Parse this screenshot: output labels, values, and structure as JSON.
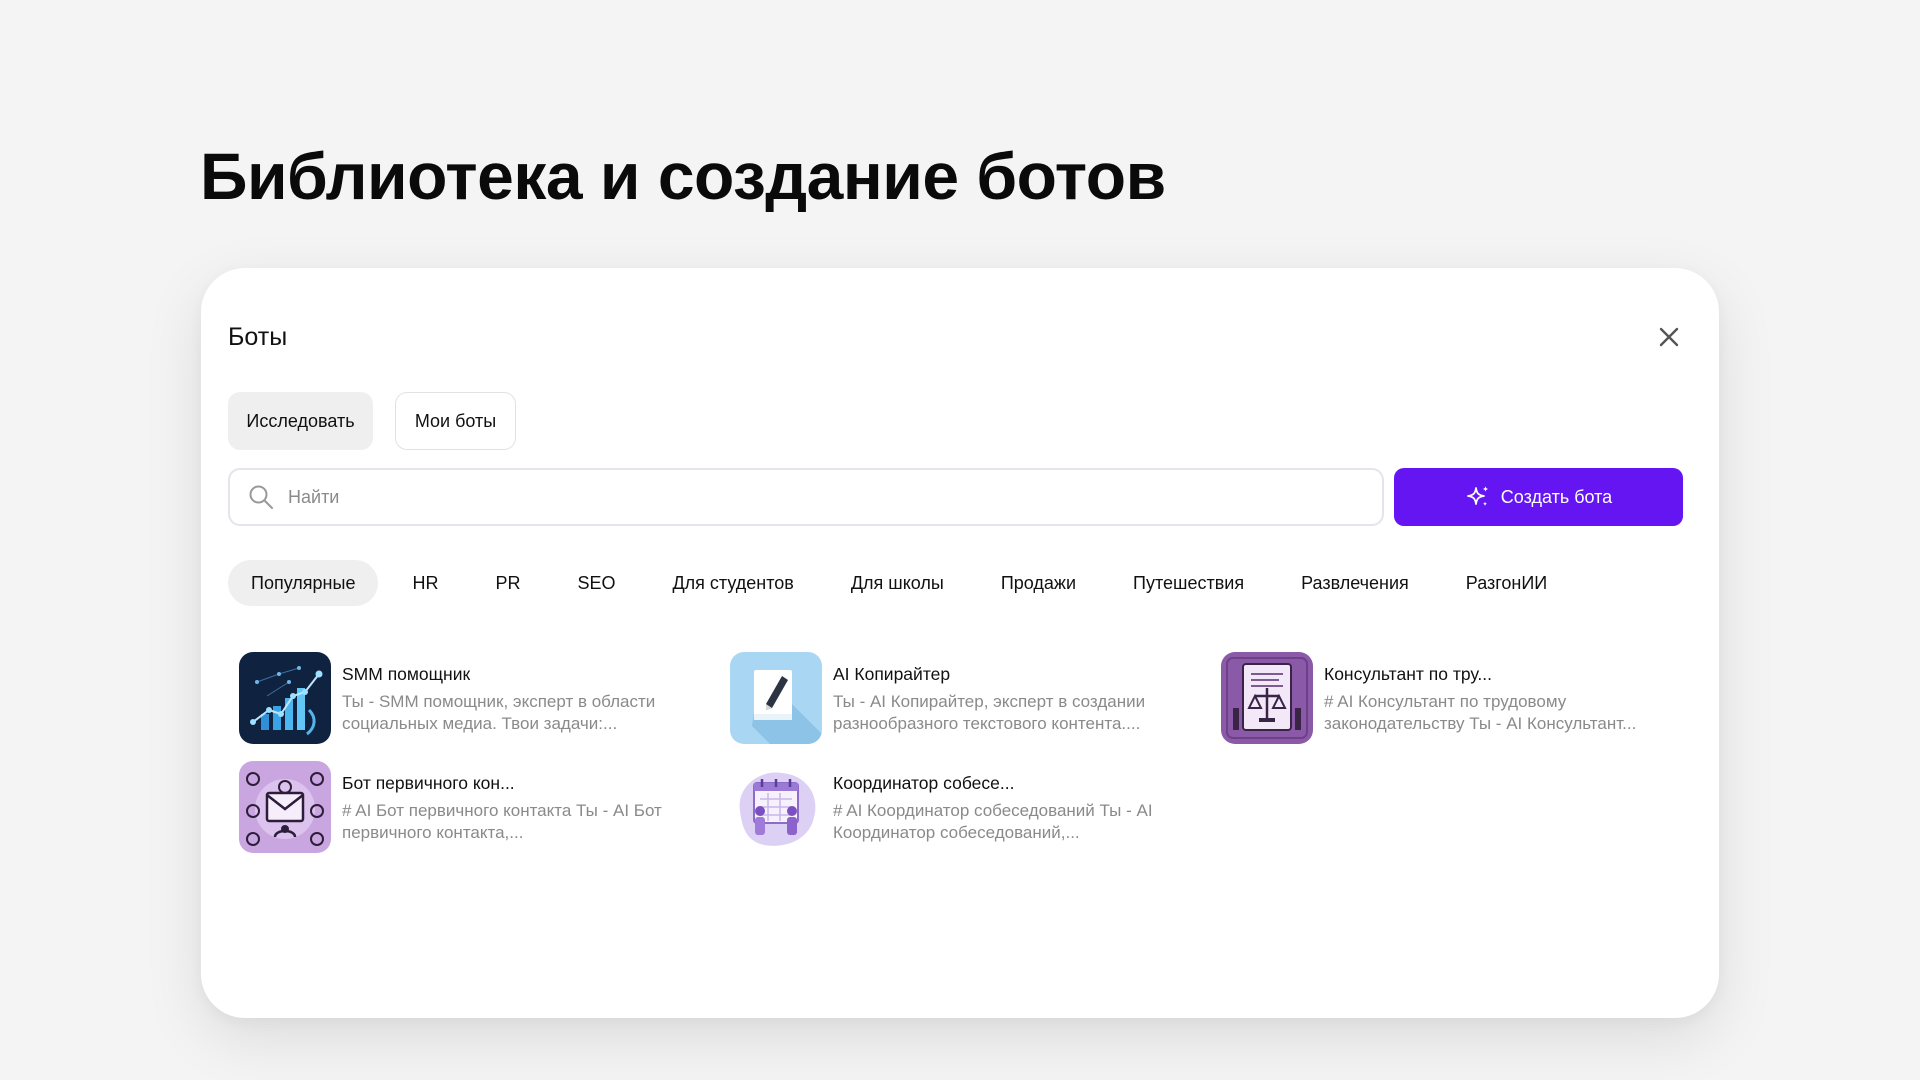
{
  "page": {
    "heading": "Библиотека и создание ботов"
  },
  "dialog": {
    "title": "Боты",
    "tabs": [
      {
        "label": "Исследовать",
        "active": true
      },
      {
        "label": "Мои боты",
        "active": false
      }
    ],
    "search": {
      "placeholder": "Найти",
      "value": ""
    },
    "create_label": "Создать бота",
    "categories": [
      {
        "label": "Популярные",
        "active": true
      },
      {
        "label": "HR"
      },
      {
        "label": "PR"
      },
      {
        "label": "SEO"
      },
      {
        "label": "Для студентов"
      },
      {
        "label": "Для школы"
      },
      {
        "label": "Продажи"
      },
      {
        "label": "Путешествия"
      },
      {
        "label": "Развлечения"
      },
      {
        "label": "РазгонИИ"
      }
    ],
    "bots": [
      {
        "name": "SMM помощник",
        "desc_1": "Ты - SMM помощник, эксперт в области",
        "desc_2": "социальных медиа. Твои задачи:...",
        "icon": "growth-chart-icon"
      },
      {
        "name": "AI Копирайтер",
        "desc_1": "Ты - AI Копирайтер, эксперт в создании",
        "desc_2": "разнообразного текстового контента....",
        "icon": "pen-paper-icon"
      },
      {
        "name": "Консультант по тру...",
        "desc_1": "# AI Консультант по трудовому",
        "desc_2": "законодательству Ты - AI Консультант...",
        "icon": "scales-document-icon"
      },
      {
        "name": "Бот первичного кон...",
        "desc_1": "# AI Бот первичного контакта Ты - AI Бот",
        "desc_2": "первичного контакта,...",
        "icon": "envelope-contacts-icon"
      },
      {
        "name": "Координатор собесе...",
        "desc_1": "# AI Координатор собеседований Ты - AI",
        "desc_2": "Координатор собеседований,...",
        "icon": "calendar-people-icon"
      }
    ]
  },
  "colors": {
    "accent": "#6415f2",
    "background": "#f4f4f4",
    "panel": "#ffffff",
    "muted_text": "#8a8a8a"
  }
}
